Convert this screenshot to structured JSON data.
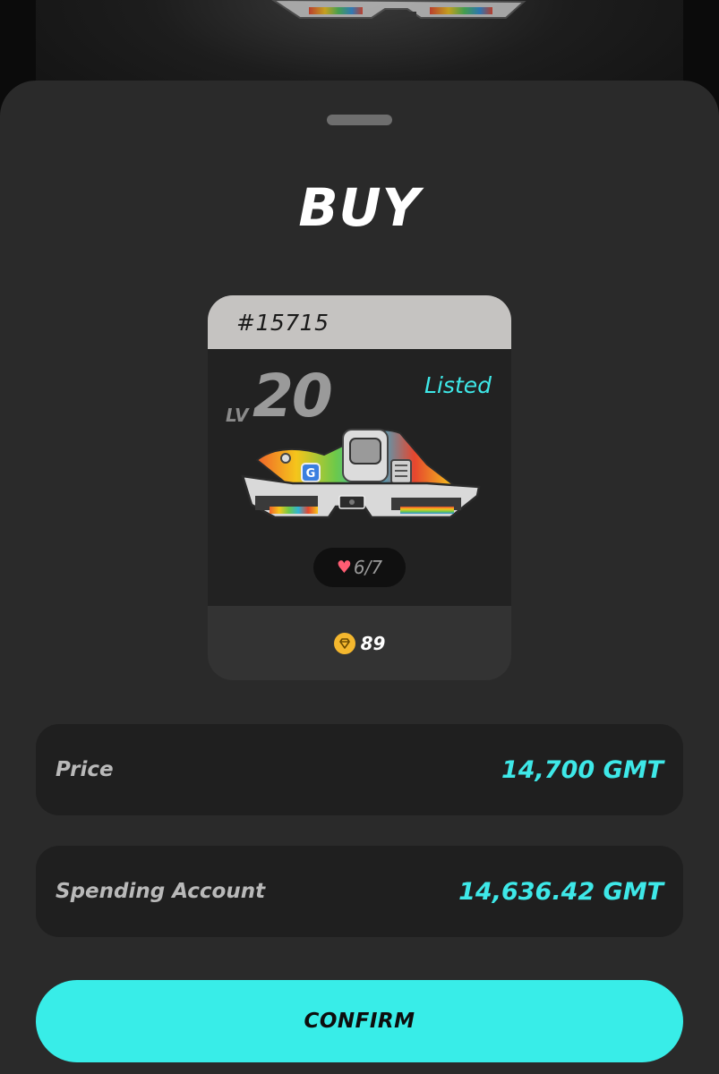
{
  "sheet": {
    "title": "BUY"
  },
  "card": {
    "id": "#15715",
    "level_label": "LV",
    "level": "20",
    "status": "Listed",
    "durability": "6/7",
    "gem_value": "89",
    "image": "sneaker-image"
  },
  "price": {
    "label": "Price",
    "value": "14,700 GMT"
  },
  "spending": {
    "label": "Spending Account",
    "value": "14,636.42 GMT"
  },
  "confirm": {
    "label": "CONFIRM"
  },
  "colors": {
    "accent": "#38ede8",
    "sheet_bg": "#2a2a2a",
    "row_bg": "#1f1f1f",
    "card_header": "#c5c3c1"
  }
}
